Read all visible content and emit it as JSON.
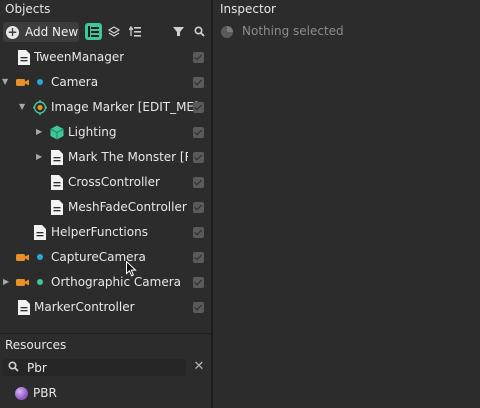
{
  "objects_panel": {
    "title": "Objects",
    "toolbar": {
      "add_new_label": "Add New"
    },
    "tree": [
      {
        "label": "TweenManager",
        "icon": "document-icon",
        "expanded": null
      },
      {
        "label": "Camera",
        "icon": "camera-icon",
        "dot_color": "#2aa8d8",
        "expanded": true
      },
      {
        "label": "Image Marker [EDIT_ME]",
        "icon": "image-marker-icon",
        "expanded": true
      },
      {
        "label": "Lighting",
        "icon": "lighting-cube-icon",
        "expanded": false
      },
      {
        "label": "Mark The Monster [REPLACE_ME]",
        "icon": "document-icon",
        "expanded": false
      },
      {
        "label": "CrossController",
        "icon": "document-icon",
        "expanded": null
      },
      {
        "label": "MeshFadeController",
        "icon": "document-icon",
        "expanded": null
      },
      {
        "label": "HelperFunctions",
        "icon": "document-icon",
        "expanded": null
      },
      {
        "label": "CaptureCamera",
        "icon": "camera-icon",
        "dot_color": "#2aa8d8",
        "expanded": null
      },
      {
        "label": "Orthographic Camera",
        "icon": "camera-icon",
        "dot_color": "#3ec79a",
        "expanded": false
      },
      {
        "label": "MarkerController",
        "icon": "document-icon",
        "expanded": null
      }
    ]
  },
  "resources_panel": {
    "title": "Resources",
    "search": {
      "value": "Pbr",
      "placeholder": ""
    },
    "items": [
      {
        "label": "PBR",
        "icon": "material-sphere-icon"
      }
    ]
  },
  "inspector_panel": {
    "title": "Inspector",
    "empty_label": "Nothing selected"
  },
  "colors": {
    "accent": "#3ec79a",
    "camera_icon": "#e7902a",
    "camera_dot": "#2aa8d8",
    "background": "#2c2c2c"
  }
}
